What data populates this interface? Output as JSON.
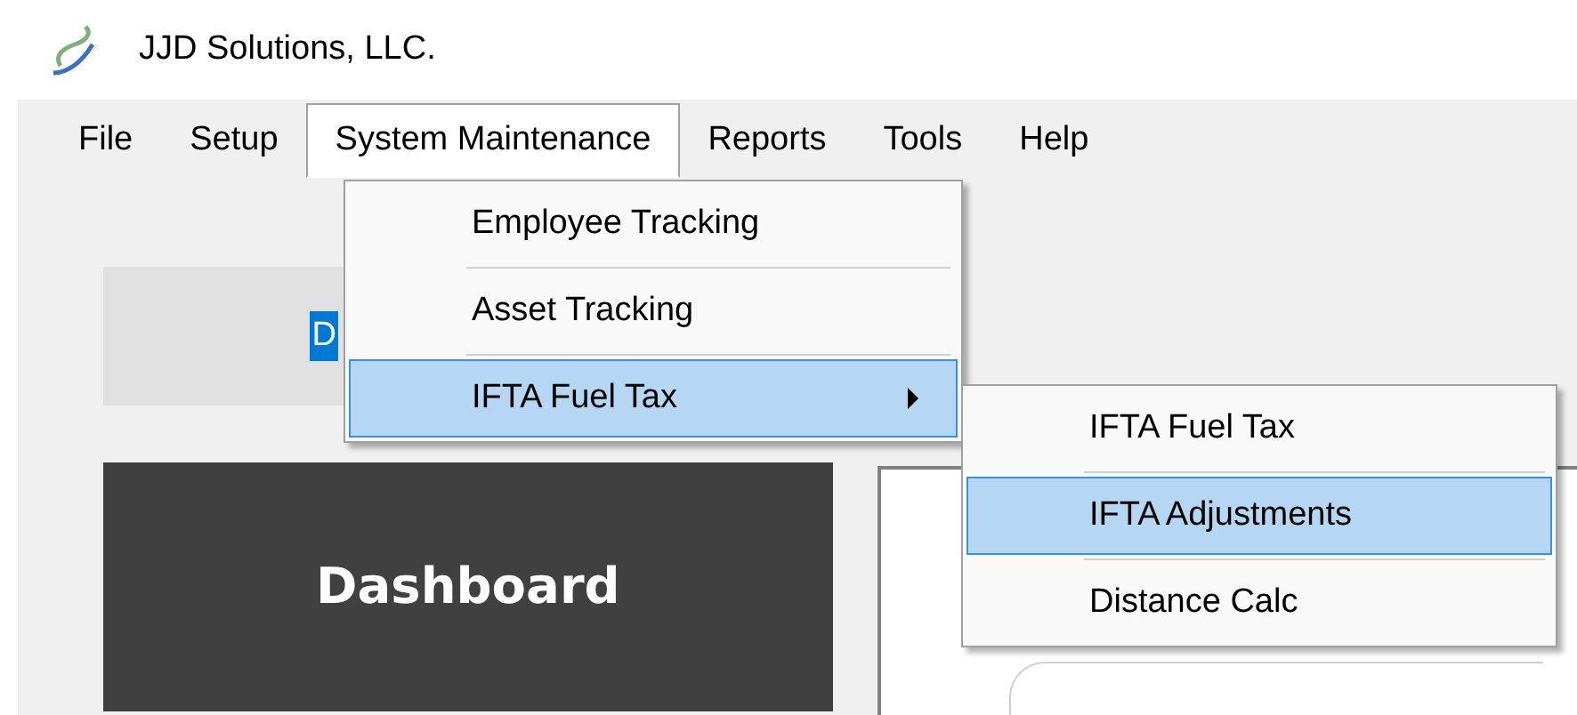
{
  "window": {
    "title": "JJD Solutions, LLC."
  },
  "menu_bar": [
    {
      "label": "File",
      "selected": false
    },
    {
      "label": "Setup",
      "selected": false
    },
    {
      "label": "System Maintenance",
      "selected": true
    },
    {
      "label": "Reports",
      "selected": false
    },
    {
      "label": "Tools",
      "selected": false
    },
    {
      "label": "Help",
      "selected": false
    }
  ],
  "open_menu": {
    "items": [
      {
        "label": "Employee Tracking",
        "kind": "item",
        "selected": false
      },
      {
        "label": "Asset Tracking",
        "kind": "item",
        "selected": false
      },
      {
        "label": "IFTA Fuel Tax",
        "kind": "submenu",
        "selected": true
      }
    ]
  },
  "submenu": {
    "items": [
      {
        "label": "IFTA Fuel Tax",
        "selected": false
      },
      {
        "label": "IFTA Adjustments",
        "selected": true
      },
      {
        "label": "Distance Calc",
        "selected": false
      }
    ]
  },
  "background": {
    "field_text": "D",
    "field_selected": true,
    "dashboard_label": "Dashboard"
  }
}
